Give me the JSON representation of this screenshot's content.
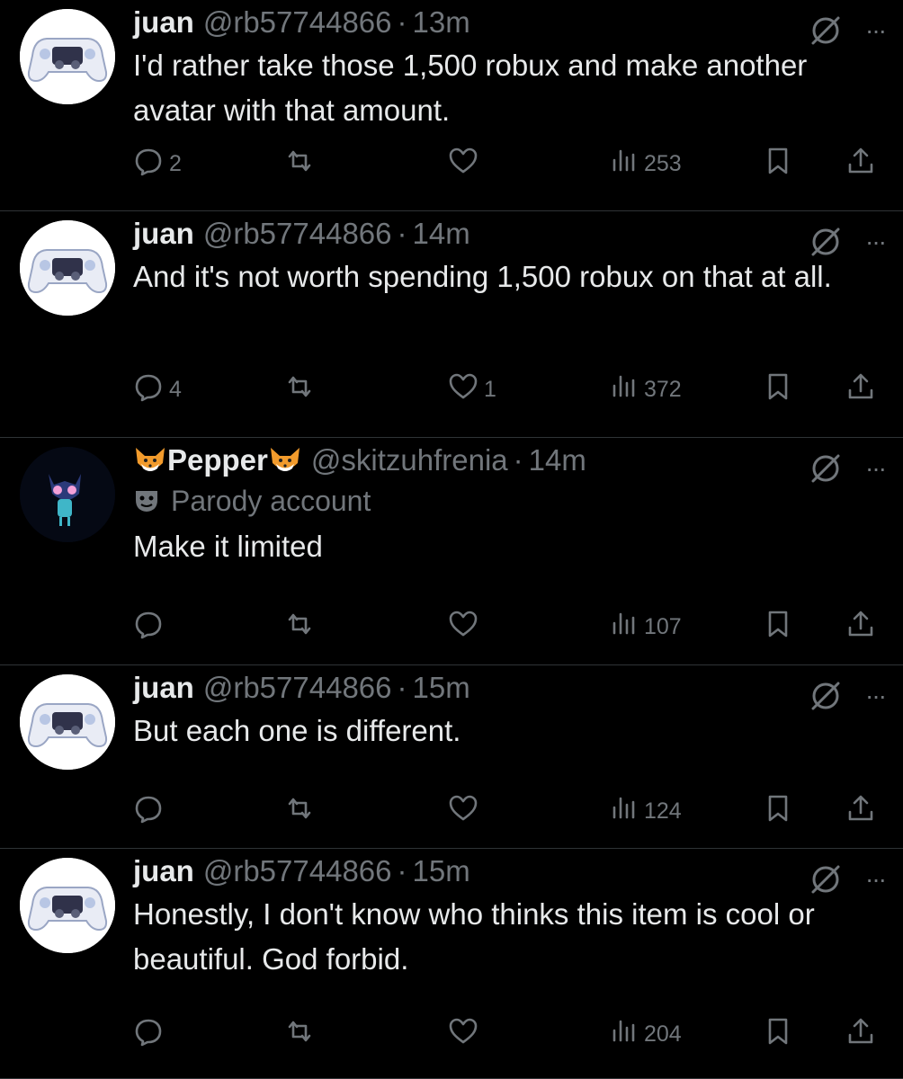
{
  "colors": {
    "background": "#000000",
    "text": "#e7e9ea",
    "muted": "#71767b",
    "divider": "#2f3336"
  },
  "tweets": [
    {
      "name": "juan",
      "handle": "@rb57744866",
      "time": "13m",
      "text": "I'd rather take those 1,500 robux and make another avatar with that amount.",
      "replies": "2",
      "retweets": "",
      "likes": "",
      "views": "253",
      "avatar": "controller-avatar"
    },
    {
      "name": "juan",
      "handle": "@rb57744866",
      "time": "14m",
      "text": "And it's not worth spending 1,500 robux on that at all.",
      "replies": "4",
      "retweets": "",
      "likes": "1",
      "views": "372",
      "avatar": "controller-avatar"
    },
    {
      "name": "Pepper",
      "handle": "@skitzuhfrenia",
      "time": "14m",
      "badge": "Parody account",
      "text": "Make it limited",
      "replies": "",
      "retweets": "",
      "likes": "",
      "views": "107",
      "avatar": "cat-avatar"
    },
    {
      "name": "juan",
      "handle": "@rb57744866",
      "time": "15m",
      "text": "But each one is different.",
      "replies": "",
      "retweets": "",
      "likes": "",
      "views": "124",
      "avatar": "controller-avatar"
    },
    {
      "name": "juan",
      "handle": "@rb57744866",
      "time": "15m",
      "text": "Honestly, I don't know who thinks this item is cool or beautiful. God forbid.",
      "replies": "",
      "retweets": "",
      "likes": "",
      "views": "204",
      "avatar": "controller-avatar"
    }
  ],
  "icons": {
    "more": "more-icon",
    "grok": "grok-icon",
    "reply": "reply-icon",
    "retweet": "retweet-icon",
    "like": "heart-icon",
    "views": "views-icon",
    "bookmark": "bookmark-icon",
    "share": "share-icon"
  },
  "more_glyph": "···"
}
